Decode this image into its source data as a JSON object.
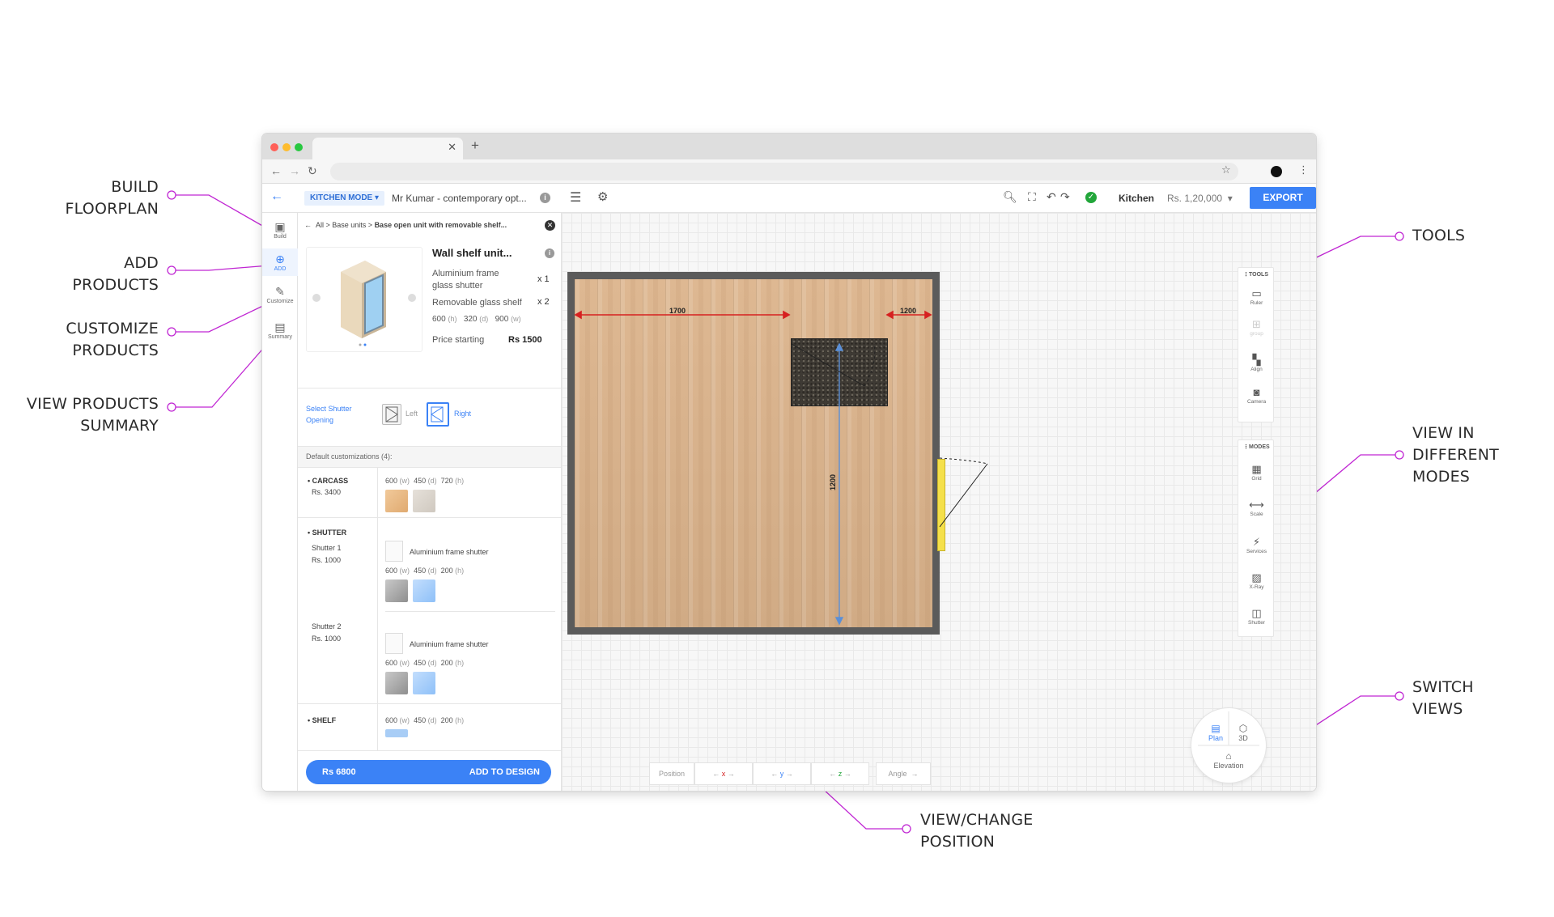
{
  "callouts": {
    "build": [
      "BUILD",
      "FLOORPLAN"
    ],
    "add": [
      "ADD",
      "PRODUCTS"
    ],
    "customize": [
      "CUSTOMIZE",
      "PRODUCTS"
    ],
    "summary": [
      "VIEW PRODUCTS",
      "SUMMARY"
    ],
    "tools": [
      "TOOLS"
    ],
    "modes": [
      "VIEW IN",
      "DIFFERENT",
      "MODES"
    ],
    "switch": [
      "SWITCH",
      "VIEWS"
    ],
    "position": [
      "VIEW/CHANGE",
      "POSITION"
    ]
  },
  "header": {
    "mode_label": "KITCHEN MODE",
    "project_name": "Mr Kumar - contemporary opt...",
    "room": "Kitchen",
    "price": "Rs. 1,20,000",
    "export_label": "EXPORT"
  },
  "rail": [
    {
      "label": "Build",
      "icon": "build-icon"
    },
    {
      "label": "ADD",
      "icon": "add-product-icon",
      "active": true
    },
    {
      "label": "Customize",
      "icon": "customize-icon"
    },
    {
      "label": "Summary",
      "icon": "summary-icon"
    }
  ],
  "panel": {
    "breadcrumb_prefix": "All > Base units > ",
    "breadcrumb_current": "Base open unit with removable shelf...",
    "product": {
      "name": "Wall shelf unit...",
      "line1": "Aluminium frame glass shutter",
      "qty1": "x 1",
      "line2": "Removable glass shelf",
      "qty2": "x 2",
      "dims": {
        "h": "600",
        "d": "320",
        "w": "900"
      },
      "price_label": "Price starting",
      "price": "Rs 1500"
    },
    "shutter_label": "Select Shutter Opening",
    "shutter_left": "Left",
    "shutter_right": "Right",
    "defaults_label": "Default customizations (4):",
    "carcass": {
      "title": "CARCASS",
      "price": "Rs. 3400",
      "dims": {
        "w": "600",
        "d": "450",
        "h": "720"
      }
    },
    "shutter": {
      "title": "SHUTTER",
      "items": [
        {
          "name": "Shutter 1",
          "price": "Rs. 1000",
          "type": "Aluminium frame shutter",
          "dims": {
            "w": "600",
            "d": "450",
            "h": "200"
          }
        },
        {
          "name": "Shutter 2",
          "price": "Rs. 1000",
          "type": "Aluminium frame shutter",
          "dims": {
            "w": "600",
            "d": "450",
            "h": "200"
          }
        }
      ]
    },
    "shelf": {
      "title": "SHELF",
      "dims": {
        "w": "600",
        "d": "450",
        "h": "200"
      }
    },
    "footer_price": "Rs 6800",
    "footer_action": "ADD TO DESIGN"
  },
  "canvas": {
    "dim_left": "1700",
    "dim_right": "1200",
    "dim_vertical": "1200"
  },
  "tools": {
    "title": "TOOLS",
    "items": [
      {
        "label": "Ruler",
        "icon": "ruler-icon"
      },
      {
        "label": "group",
        "icon": "group-icon",
        "disabled": true
      },
      {
        "label": "Align",
        "icon": "align-icon"
      },
      {
        "label": "Camera",
        "icon": "camera-icon"
      }
    ]
  },
  "modes": {
    "title": "MODES",
    "items": [
      {
        "label": "Grid",
        "icon": "grid-icon"
      },
      {
        "label": "Scale",
        "icon": "scale-icon"
      },
      {
        "label": "Services",
        "icon": "services-icon"
      },
      {
        "label": "X-Ray",
        "icon": "xray-icon"
      },
      {
        "label": "Shutter",
        "icon": "shutter-icon"
      }
    ]
  },
  "views": {
    "plan": "Plan",
    "three_d": "3D",
    "elevation": "Elevation"
  },
  "position_bar": {
    "position": "Position",
    "x": "x",
    "y": "y",
    "z": "z",
    "angle": "Angle"
  },
  "colors": {
    "accent": "#3b82f6",
    "callout": "#c026d3",
    "dimension": "#d62020"
  }
}
